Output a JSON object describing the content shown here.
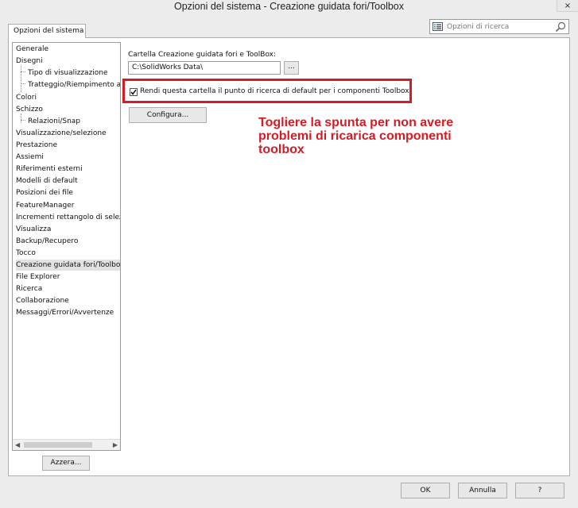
{
  "window": {
    "title": "Opzioni del sistema - Creazione guidata fori/Toolbox",
    "close_label": "×"
  },
  "tab": {
    "label": "Opzioni del sistema"
  },
  "search": {
    "placeholder": "Opzioni di ricerca"
  },
  "tree": {
    "items": [
      {
        "label": "Generale",
        "level": 0
      },
      {
        "label": "Disegni",
        "level": 0
      },
      {
        "label": "Tipo di visualizzazione",
        "level": 1
      },
      {
        "label": "Tratteggio/Riempimento area",
        "level": 1
      },
      {
        "label": "Colori",
        "level": 0
      },
      {
        "label": "Schizzo",
        "level": 0
      },
      {
        "label": "Relazioni/Snap",
        "level": 1
      },
      {
        "label": "Visualizzazione/selezione",
        "level": 0
      },
      {
        "label": "Prestazione",
        "level": 0
      },
      {
        "label": "Assiemi",
        "level": 0
      },
      {
        "label": "Riferimenti esterni",
        "level": 0
      },
      {
        "label": "Modelli di default",
        "level": 0
      },
      {
        "label": "Posizioni dei file",
        "level": 0
      },
      {
        "label": "FeatureManager",
        "level": 0
      },
      {
        "label": "Incrementi rettangolo di selezione",
        "level": 0
      },
      {
        "label": "Visualizza",
        "level": 0
      },
      {
        "label": "Backup/Recupero",
        "level": 0
      },
      {
        "label": "Tocco",
        "level": 0
      },
      {
        "label": "Creazione guidata fori/Toolbox",
        "level": 0,
        "selected": true
      },
      {
        "label": "File Explorer",
        "level": 0
      },
      {
        "label": "Ricerca",
        "level": 0
      },
      {
        "label": "Collaborazione",
        "level": 0
      },
      {
        "label": "Messaggi/Errori/Avvertenze",
        "level": 0
      }
    ],
    "reset_label": "Azzera..."
  },
  "content": {
    "folder_label": "Cartella Creazione guidata fori e ToolBox:",
    "folder_value": "C:\\SolidWorks Data\\",
    "browse_label": "...",
    "checkbox_label": "Rendi questa cartella il punto di ricerca di default per i componenti Toolbox",
    "checkbox_checked": true,
    "configure_label": "Configura...",
    "annotation": "Togliere la spunta per non avere problemi di ricarica componenti toolbox"
  },
  "footer": {
    "ok_label": "OK",
    "cancel_label": "Annulla",
    "help_label": "?"
  },
  "colors": {
    "highlight": "#d51b24",
    "background": "#ececec"
  }
}
